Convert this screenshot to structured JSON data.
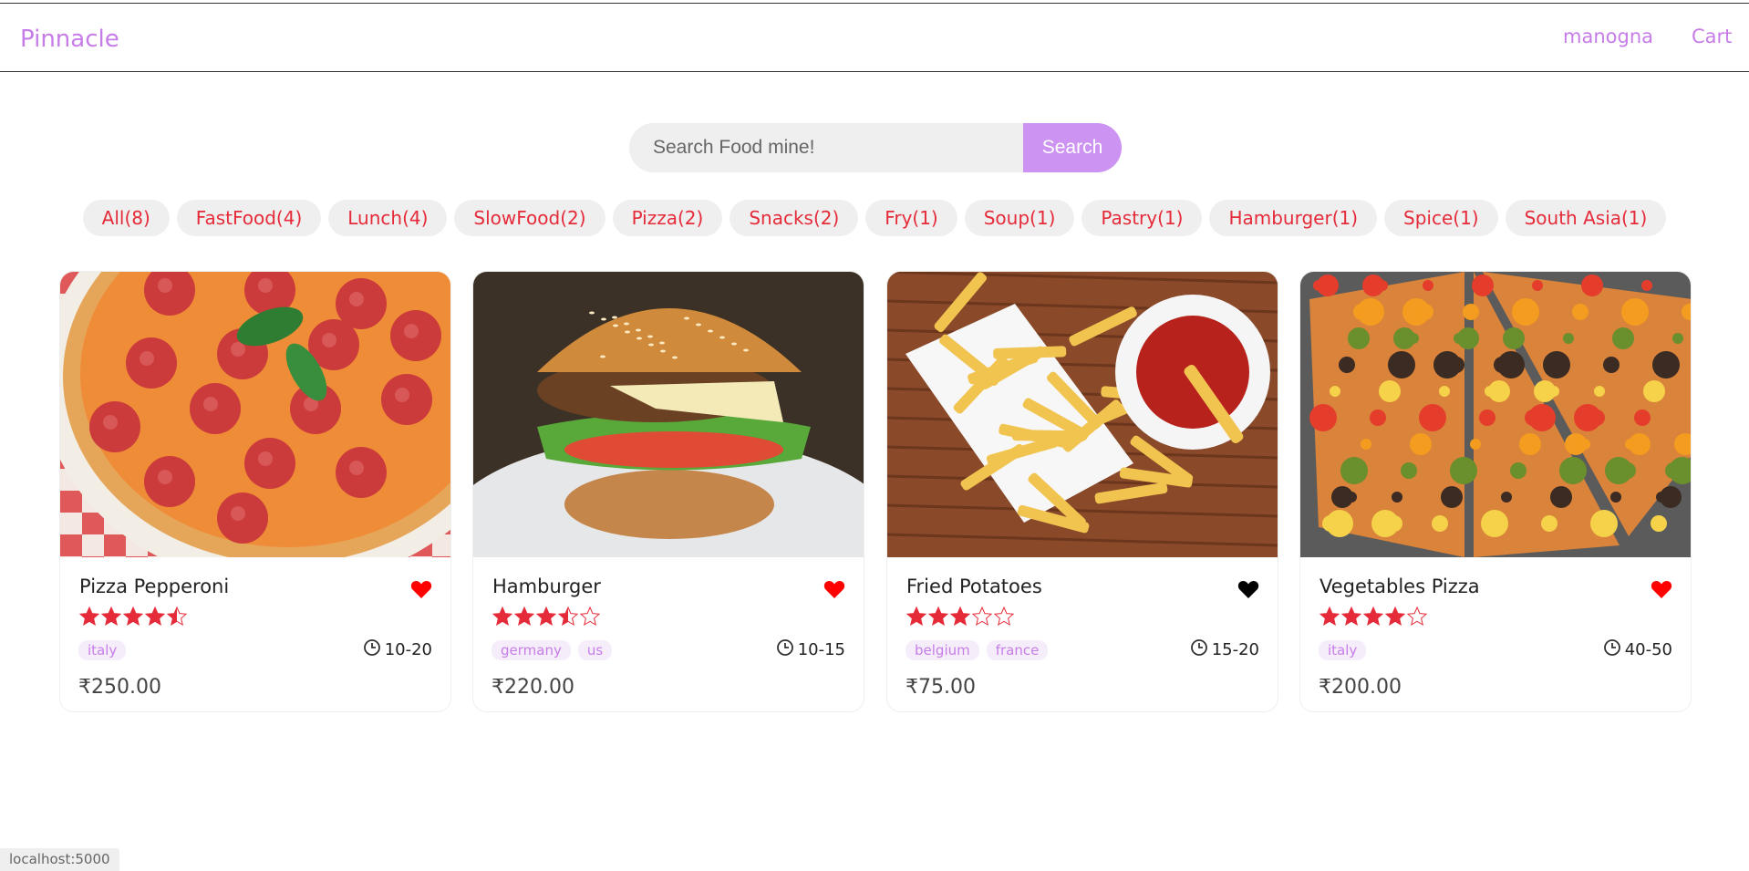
{
  "header": {
    "logo": "Pinnacle",
    "user": "manogna",
    "cart": "Cart"
  },
  "search": {
    "placeholder": "Search Food mine!",
    "button": "Search"
  },
  "tags": [
    "All(8)",
    "FastFood(4)",
    "Lunch(4)",
    "SlowFood(2)",
    "Pizza(2)",
    "Snacks(2)",
    "Fry(1)",
    "Soup(1)",
    "Pastry(1)",
    "Hamburger(1)",
    "Spice(1)",
    "South Asia(1)"
  ],
  "foods": [
    {
      "name": "Pizza Pepperoni",
      "stars": 4.5,
      "favorite": true,
      "origins": [
        "italy"
      ],
      "time": "10-20",
      "price": "₹250.00",
      "image": "pizza-pepperoni-photo"
    },
    {
      "name": "Hamburger",
      "stars": 3.5,
      "favorite": true,
      "origins": [
        "germany",
        "us"
      ],
      "time": "10-15",
      "price": "₹220.00",
      "image": "hamburger-photo"
    },
    {
      "name": "Fried Potatoes",
      "stars": 3,
      "favorite": false,
      "origins": [
        "belgium",
        "france"
      ],
      "time": "15-20",
      "price": "₹75.00",
      "image": "fried-potatoes-photo"
    },
    {
      "name": "Vegetables Pizza",
      "stars": 4,
      "favorite": true,
      "origins": [
        "italy"
      ],
      "time": "40-50",
      "price": "₹200.00",
      "image": "vegetables-pizza-photo"
    }
  ],
  "colors": {
    "accent": "#c77de8",
    "tag_text": "#e52b39",
    "star": "#e52b39",
    "favorite": "#ff0000",
    "not_favorite": "#000000"
  },
  "status_url": "localhost:5000"
}
